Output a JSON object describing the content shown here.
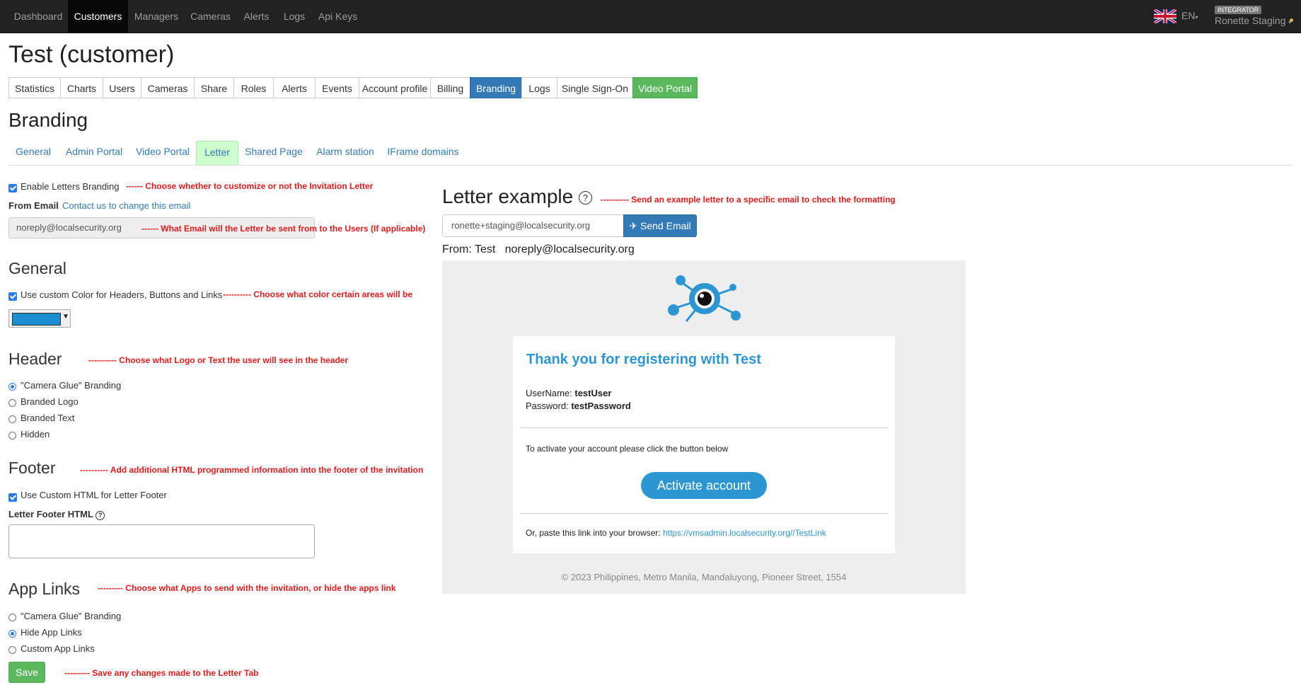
{
  "nav": {
    "items": [
      "Dashboard",
      "Customers",
      "Managers",
      "Cameras",
      "Alerts",
      "Logs",
      "Api Keys"
    ],
    "active": "Customers",
    "lang": "EN",
    "role_badge": "INTEGRATOR",
    "user": "Ronette Staging",
    "status_color": "#f0ad4e"
  },
  "page": {
    "title": "Test (customer)",
    "tabs": [
      "Statistics",
      "Charts",
      "Users",
      "Cameras",
      "Share",
      "Roles",
      "Alerts",
      "Events",
      "Account profile",
      "Billing",
      "Branding",
      "Logs",
      "Single Sign-On",
      "Video Portal"
    ],
    "active_tab": "Branding",
    "accent_color": "#337ab7",
    "success_color": "#5cb85c"
  },
  "branding": {
    "title": "Branding",
    "subtabs": [
      "General",
      "Admin Portal",
      "Video Portal",
      "Letter",
      "Shared Page",
      "Alarm station",
      "IFrame domains"
    ],
    "active_subtab": "Letter"
  },
  "form": {
    "enable_label": "Enable Letters Branding",
    "enable_checked": true,
    "enable_note": "------ Choose whether to customize or not the Invitation Letter",
    "from_email_label": "From Email",
    "from_email_link": "Contact us to change this email",
    "from_email_value": "noreply@localsecurity.org",
    "from_email_note": "------ What Email will the Letter be sent from to the Users (If applicable)",
    "general": {
      "title": "General",
      "custom_color_label": "Use custom Color for Headers, Buttons and Links",
      "custom_color_checked": true,
      "custom_color_note": "---------- Choose what color certain areas will be",
      "color_value": "#1a8ed0"
    },
    "header": {
      "title": "Header",
      "note": "---------- Choose what Logo or Text the user will see in the header",
      "options": [
        "\"Camera Glue\" Branding",
        "Branded Logo",
        "Branded Text",
        "Hidden"
      ],
      "selected": 0
    },
    "footer": {
      "title": "Footer",
      "note": "---------- Add additional HTML programmed information into the footer of the invitation",
      "custom_html_label": "Use Custom HTML for Letter Footer",
      "custom_html_checked": true,
      "html_label": "Letter Footer HTML",
      "html_value": ""
    },
    "app_links": {
      "title": "App Links",
      "note": "--------- Choose what Apps to send with the invitation, or hide the apps link",
      "options": [
        "\"Camera Glue\" Branding",
        "Hide App Links",
        "Custom App Links"
      ],
      "selected": 1
    },
    "save_label": "Save",
    "save_note": "--------- Save any changes made to the Letter Tab"
  },
  "letter": {
    "title": "Letter example",
    "note": "---------- Send an example letter to a specific email to check the formatting",
    "email_value": "ronette+staging@localsecurity.org",
    "send_label": "Send Email",
    "from_prefix": "From:",
    "from_name": "Test",
    "from_email": "noreply@localsecurity.org",
    "card_title": "Thank you for registering with Test",
    "username_label": "UserName:",
    "username_value": "testUser",
    "password_label": "Password:",
    "password_value": "testPassword",
    "activate_text": "To activate your account please click the button below",
    "activate_label": "Activate account",
    "paste_text": "Or, paste this link into your browser:",
    "link": "https://vmsadmin.localsecurity.org//TestLink",
    "footer": "© 2023 Philippines, Metro Manila, Mandaluyong, Pioneer Street, 1554",
    "brand_color": "#2c96d2"
  }
}
